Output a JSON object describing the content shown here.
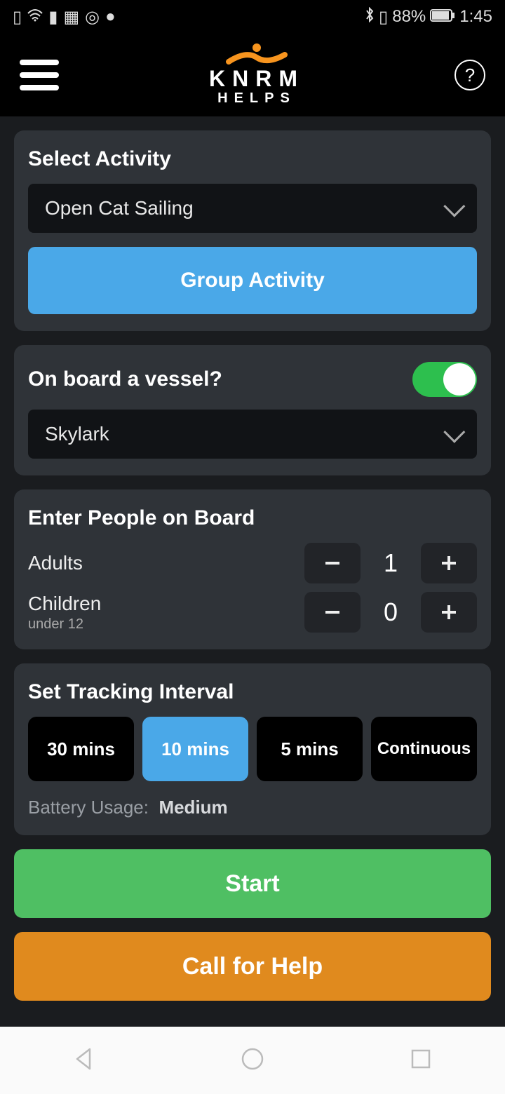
{
  "status": {
    "battery_pct": "88%",
    "time": "1:45"
  },
  "header": {
    "brand_line1": "KNRM",
    "brand_line2": "HELPS",
    "help_symbol": "?"
  },
  "activity": {
    "title": "Select Activity",
    "selected": "Open Cat Sailing",
    "group_button": "Group Activity"
  },
  "vessel": {
    "question": "On board a vessel?",
    "toggle_on": true,
    "selected": "Skylark"
  },
  "people": {
    "title": "Enter People on Board",
    "adults_label": "Adults",
    "adults_count": "1",
    "children_label": "Children",
    "children_sub": "under 12",
    "children_count": "0"
  },
  "tracking": {
    "title": "Set Tracking Interval",
    "options": [
      "30 mins",
      "10 mins",
      "5 mins",
      "Continuous"
    ],
    "selected_index": 1,
    "battery_label": "Battery Usage:",
    "battery_value": "Medium"
  },
  "actions": {
    "start": "Start",
    "call_help": "Call for Help"
  }
}
